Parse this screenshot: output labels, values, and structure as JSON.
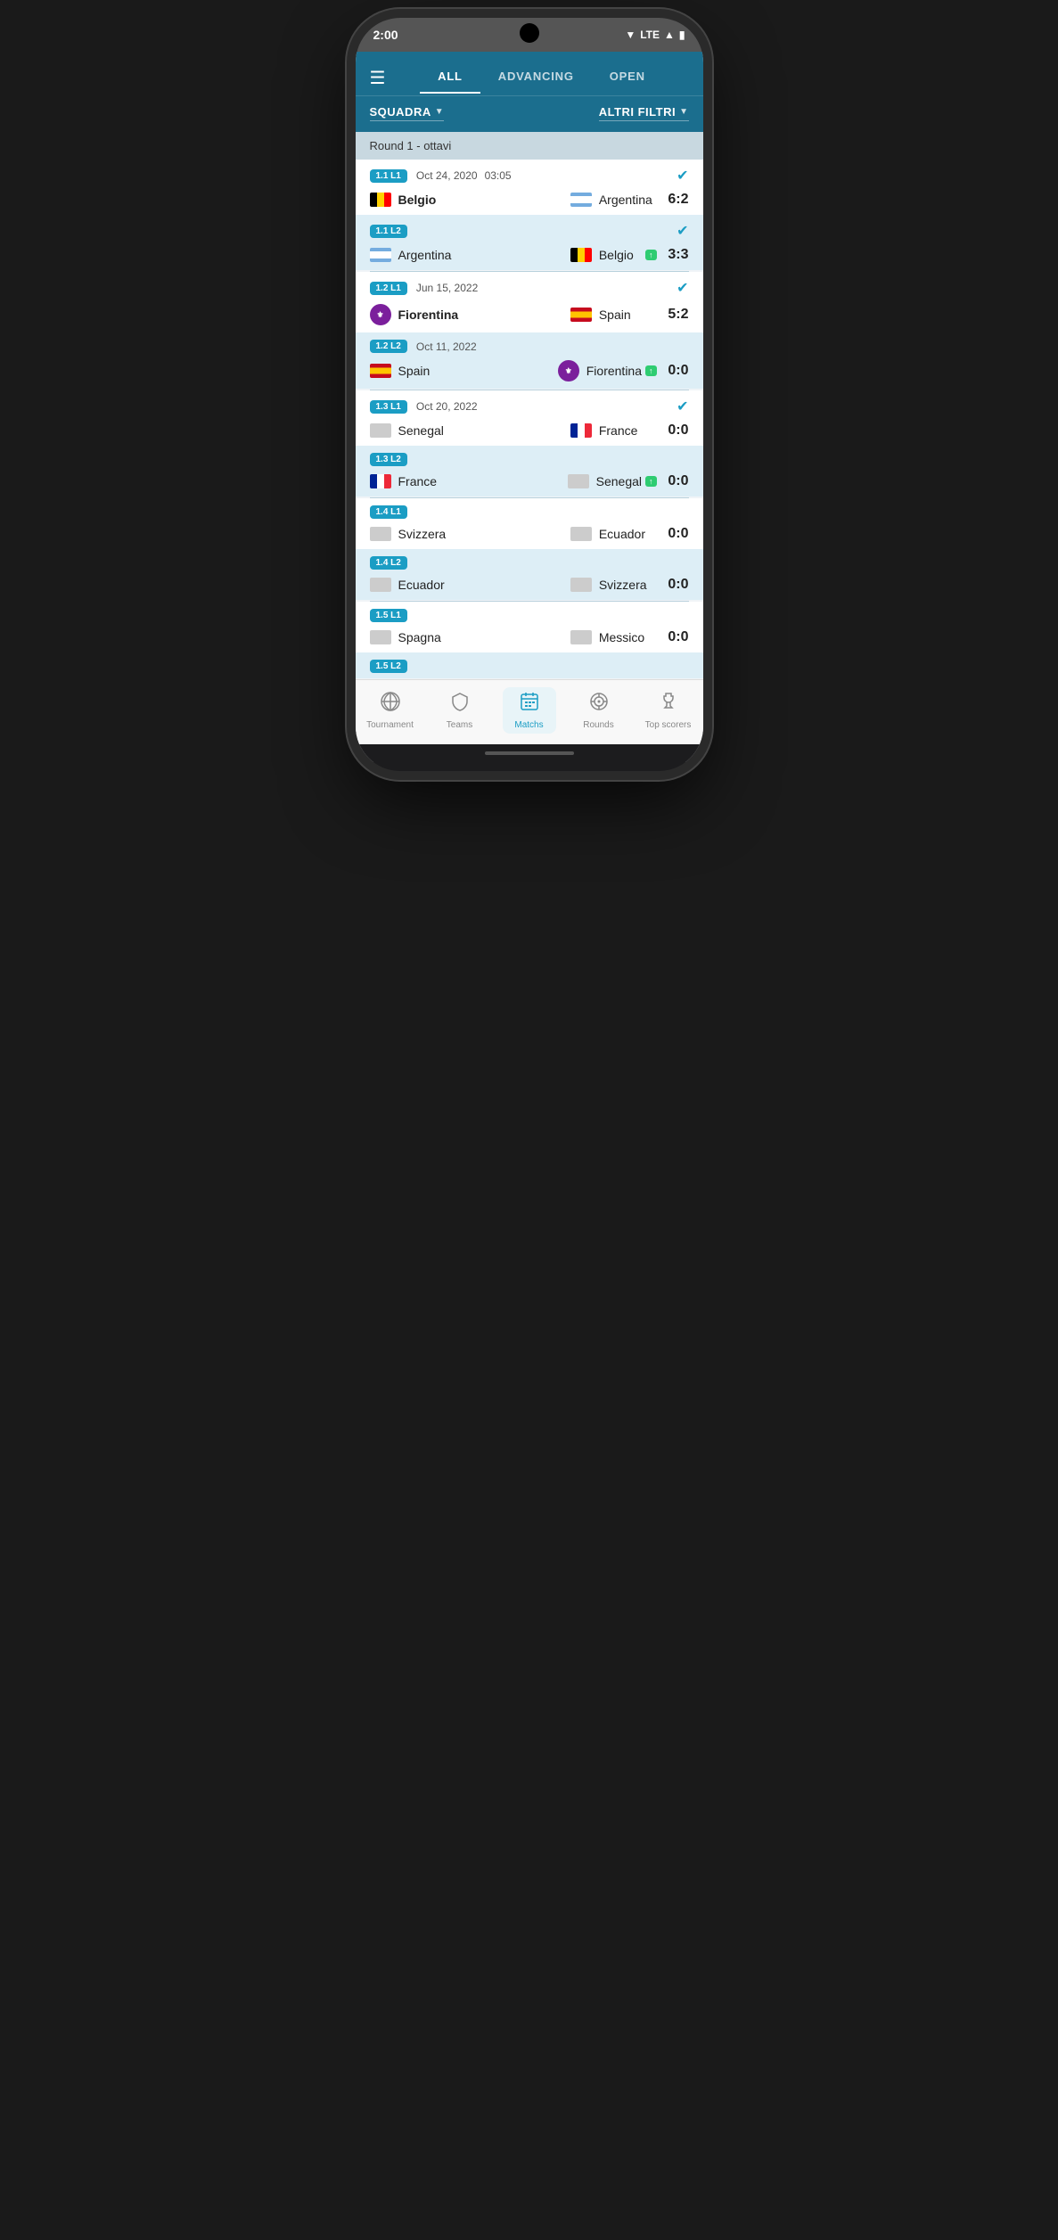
{
  "phone": {
    "time": "2:00",
    "status_icons": "▼ LTE ▲ 🔋"
  },
  "header": {
    "tabs": [
      {
        "id": "all",
        "label": "ALL",
        "active": true
      },
      {
        "id": "advancing",
        "label": "ADVANCING",
        "active": false
      },
      {
        "id": "open",
        "label": "OPEN",
        "active": false
      }
    ],
    "filters": [
      {
        "id": "squadra",
        "label": "SQUADRA"
      },
      {
        "id": "altri_filtri",
        "label": "ALTRI FILTRI"
      }
    ]
  },
  "round_label": "Round 1 - ottavi",
  "matches": [
    {
      "id": "1.1",
      "leg1": {
        "label": "1.1 L1",
        "date": "Oct 24, 2020",
        "time": "03:05",
        "completed": true,
        "team1": {
          "name": "Belgio",
          "flag": "belgium",
          "bold": true
        },
        "team2": {
          "name": "Argentina",
          "flag": "argentina",
          "bold": false
        },
        "score": "6:2"
      },
      "leg2": {
        "label": "1.1 L2",
        "date": "",
        "time": "",
        "completed": true,
        "team1": {
          "name": "Argentina",
          "flag": "argentina",
          "bold": false
        },
        "team2": {
          "name": "Belgio",
          "flag": "belgium",
          "bold": false,
          "advancing": true
        },
        "score": "3:3"
      }
    },
    {
      "id": "1.2",
      "leg1": {
        "label": "1.2 L1",
        "date": "Jun 15, 2022",
        "time": "",
        "completed": true,
        "team1": {
          "name": "Fiorentina",
          "flag": "fiorentina",
          "bold": true
        },
        "team2": {
          "name": "Spain",
          "flag": "spain",
          "bold": false
        },
        "score": "5:2"
      },
      "leg2": {
        "label": "1.2 L2",
        "date": "Oct 11, 2022",
        "time": "",
        "completed": false,
        "team1": {
          "name": "Spain",
          "flag": "spain",
          "bold": false
        },
        "team2": {
          "name": "Fiorentina",
          "flag": "fiorentina",
          "bold": false,
          "advancing": true
        },
        "score": "0:0"
      }
    },
    {
      "id": "1.3",
      "leg1": {
        "label": "1.3 L1",
        "date": "Oct 20, 2022",
        "time": "",
        "completed": true,
        "team1": {
          "name": "Senegal",
          "flag": "none",
          "bold": false
        },
        "team2": {
          "name": "France",
          "flag": "france",
          "bold": false
        },
        "score": "0:0"
      },
      "leg2": {
        "label": "1.3 L2",
        "date": "",
        "time": "",
        "completed": false,
        "team1": {
          "name": "France",
          "flag": "france",
          "bold": false
        },
        "team2": {
          "name": "Senegal",
          "flag": "none",
          "bold": false,
          "advancing": true
        },
        "score": "0:0"
      }
    },
    {
      "id": "1.4",
      "leg1": {
        "label": "1.4 L1",
        "date": "",
        "time": "",
        "completed": false,
        "team1": {
          "name": "Svizzera",
          "flag": "none",
          "bold": false
        },
        "team2": {
          "name": "Ecuador",
          "flag": "none",
          "bold": false
        },
        "score": "0:0"
      },
      "leg2": {
        "label": "1.4 L2",
        "date": "",
        "time": "",
        "completed": false,
        "team1": {
          "name": "Ecuador",
          "flag": "none",
          "bold": false
        },
        "team2": {
          "name": "Svizzera",
          "flag": "none",
          "bold": false
        },
        "score": "0:0"
      }
    },
    {
      "id": "1.5",
      "leg1": {
        "label": "1.5 L1",
        "date": "",
        "time": "",
        "completed": false,
        "team1": {
          "name": "Spagna",
          "flag": "none",
          "bold": false
        },
        "team2": {
          "name": "Messico",
          "flag": "none",
          "bold": false
        },
        "score": "0:0"
      },
      "leg2": {
        "label": "1.5 L2",
        "date": "",
        "time": "",
        "completed": false,
        "team1": {
          "name": "...",
          "flag": "none",
          "bold": false
        },
        "team2": {
          "name": "...",
          "flag": "none",
          "bold": false
        },
        "score": ""
      }
    }
  ],
  "bottom_nav": [
    {
      "id": "tournament",
      "label": "Tournament",
      "icon": "⚽",
      "active": false
    },
    {
      "id": "teams",
      "label": "Teams",
      "icon": "🛡",
      "active": false
    },
    {
      "id": "matchs",
      "label": "Matchs",
      "icon": "📅",
      "active": true
    },
    {
      "id": "rounds",
      "label": "Rounds",
      "icon": "◎",
      "active": false
    },
    {
      "id": "top_scorers",
      "label": "Top scorers",
      "icon": "👕",
      "active": false
    }
  ]
}
